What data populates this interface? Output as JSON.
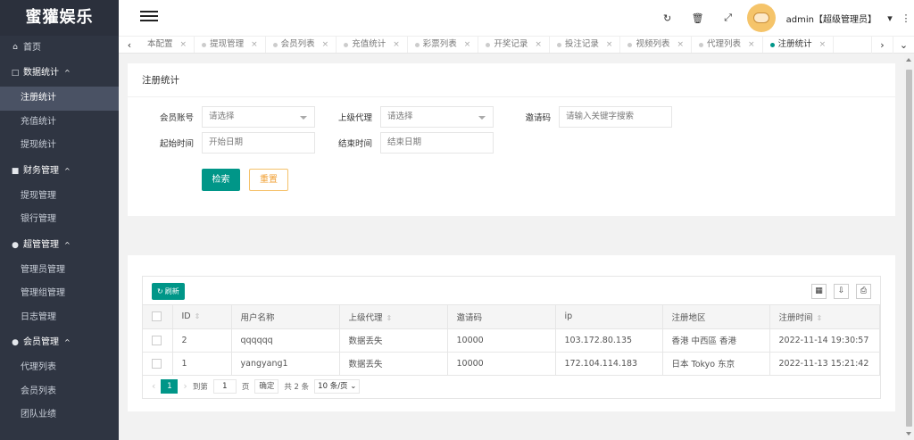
{
  "app": {
    "logo": "蜜獾娱乐"
  },
  "sidebar": {
    "home": "首页",
    "groups": [
      {
        "label": "数据统计",
        "items": [
          "注册统计",
          "充值统计",
          "提现统计"
        ]
      },
      {
        "label": "财务管理",
        "items": [
          "提现管理",
          "银行管理"
        ]
      },
      {
        "label": "超管管理",
        "items": [
          "管理员管理",
          "管理组管理",
          "日志管理"
        ]
      },
      {
        "label": "会员管理",
        "items": [
          "代理列表",
          "会员列表",
          "团队业绩"
        ]
      }
    ],
    "active": "注册统计"
  },
  "header": {
    "user": "admin【超级管理员】",
    "icons": [
      "refresh-icon",
      "trash-icon",
      "fullscreen-icon"
    ]
  },
  "tabs": {
    "items": [
      "本配置",
      "提现管理",
      "会员列表",
      "充值统计",
      "彩票列表",
      "开奖记录",
      "投注记录",
      "视频列表",
      "代理列表",
      "注册统计"
    ],
    "active": "注册统计"
  },
  "filter": {
    "title": "注册统计",
    "member_label": "会员账号",
    "member_value": "请选择",
    "agent_label": "上级代理",
    "agent_value": "请选择",
    "invite_label": "邀请码",
    "invite_placeholder": "请输入关键字搜索",
    "start_label": "起始时间",
    "start_placeholder": "开始日期",
    "end_label": "结束时间",
    "end_placeholder": "结束日期",
    "search_button": "检索",
    "reset_button": "重置"
  },
  "table": {
    "refresh_label": "刷新",
    "columns": [
      "ID",
      "用户名称",
      "上级代理",
      "邀请码",
      "ip",
      "注册地区",
      "注册时间"
    ],
    "rows": [
      {
        "id": "2",
        "name": "qqqqqq",
        "agent": "数据丢失",
        "invite": "10000",
        "ip": "103.172.80.135",
        "region": "香港 中西區 香港",
        "time": "2022-11-14 19:30:57"
      },
      {
        "id": "1",
        "name": "yangyang1",
        "agent": "数据丢失",
        "invite": "10000",
        "ip": "172.104.114.183",
        "region": "日本 Tokyo 东京",
        "time": "2022-11-13 15:21:42"
      }
    ]
  },
  "pager": {
    "current": "1",
    "goto_label": "到第",
    "goto_value": "1",
    "page_label": "页",
    "confirm": "确定",
    "total": "共 2 条",
    "per_page": "10 条/页"
  },
  "colors": {
    "primary": "#009688",
    "sidebar": "#2f3542",
    "warning": "#f0a035"
  }
}
